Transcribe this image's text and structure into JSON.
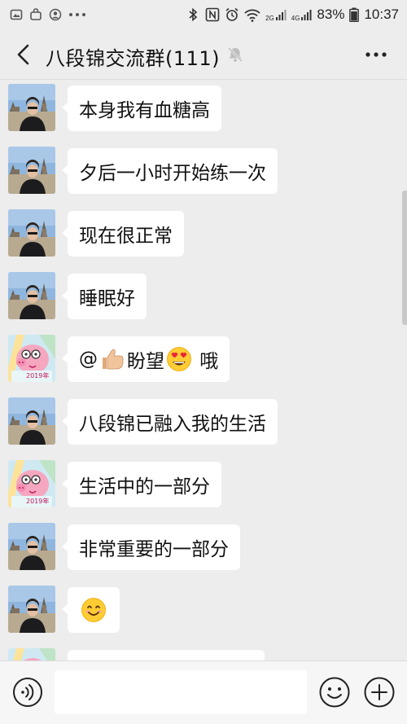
{
  "status_bar": {
    "battery": "83%",
    "time": "10:37",
    "network_2g": "2G",
    "network_4g": "4G"
  },
  "header": {
    "title": "八段锦交流群(111)",
    "icons": [
      "back-arrow-icon",
      "mute-bell-icon",
      "more-icon"
    ]
  },
  "messages": [
    {
      "sender": "a",
      "parts": [
        "本身我有血糖高"
      ]
    },
    {
      "sender": "a",
      "parts": [
        "夕后一小时开始练一次"
      ]
    },
    {
      "sender": "a",
      "parts": [
        "现在很正常"
      ]
    },
    {
      "sender": "a",
      "parts": [
        "睡眠好"
      ]
    },
    {
      "sender": "b",
      "parts": [
        "@",
        "thumbs-up-emoji",
        "盼望",
        "heart-eyes-emoji",
        " 哦"
      ]
    },
    {
      "sender": "a",
      "parts": [
        "八段锦已融入我的生活"
      ]
    },
    {
      "sender": "b",
      "parts": [
        "生活中的一部分"
      ]
    },
    {
      "sender": "a",
      "parts": [
        "非常重要的一部分"
      ]
    },
    {
      "sender": "a",
      "parts": [
        "smiling-emoji"
      ]
    },
    {
      "sender": "b",
      "parts": [
        ""
      ]
    }
  ],
  "avatar_b_caption": "2019年",
  "input": {
    "placeholder": "",
    "icons": [
      "voice-icon",
      "emoji-icon",
      "plus-icon"
    ]
  },
  "colors": {
    "background": "#ededed",
    "bubble": "#ffffff",
    "input_bar": "#f6f6f6"
  }
}
